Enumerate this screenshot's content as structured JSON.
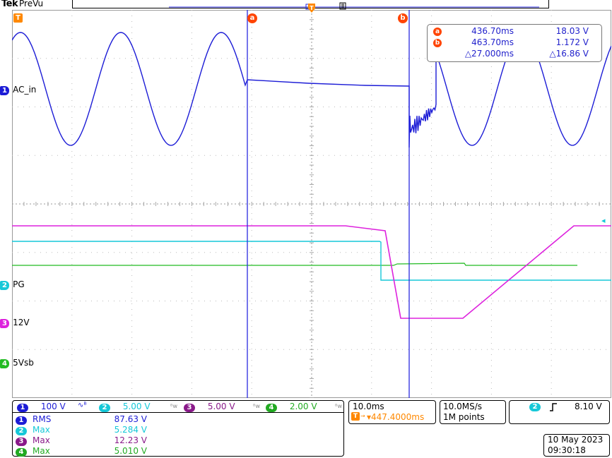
{
  "header": {
    "brand": "Tek",
    "mode": "PreVu"
  },
  "channels": {
    "ch1_label": "AC_in",
    "ch2_label": "PG",
    "ch3_label": "12V",
    "ch4_label": "5Vsb",
    "ch1_num": "1",
    "ch2_num": "2",
    "ch3_num": "3",
    "ch4_num": "4"
  },
  "cursor_markers": {
    "a": "a",
    "b": "b",
    "trigger": "T"
  },
  "cursor_readout": {
    "a_time": "436.70ms",
    "a_value": "18.03 V",
    "b_time": "463.70ms",
    "b_value": "1.172 V",
    "delta_time": "△27.000ms",
    "delta_value": "△16.86 V"
  },
  "vertical_scales": {
    "ch1": "100 V",
    "ch2": "5.00 V",
    "ch3": "5.00 V",
    "ch4": "2.00 V"
  },
  "measurements": [
    {
      "num": "1",
      "name": "RMS",
      "value": "87.63 V"
    },
    {
      "num": "2",
      "name": "Max",
      "value": "5.284 V"
    },
    {
      "num": "3",
      "name": "Max",
      "value": "12.23 V"
    },
    {
      "num": "4",
      "name": "Max",
      "value": "5.010 V"
    }
  ],
  "timebase": {
    "scale": "10.0ms",
    "position": "▾447.4000ms"
  },
  "acquisition": {
    "rate": "10.0MS/s",
    "points": "1M points"
  },
  "trigger": {
    "source": "2",
    "slope_icon": "rising-edge-icon",
    "level": "8.10 V"
  },
  "datetime": {
    "date": "10 May 2023",
    "time": "09:30:18"
  },
  "colors": {
    "ch1": "#1c1cd6",
    "ch2": "#16c8d8",
    "ch3": "#dd22dd",
    "ch4": "#22bb22",
    "cursor": "#2a2ae0",
    "trigger": "#ff8800",
    "marker": "#ff4400"
  }
}
